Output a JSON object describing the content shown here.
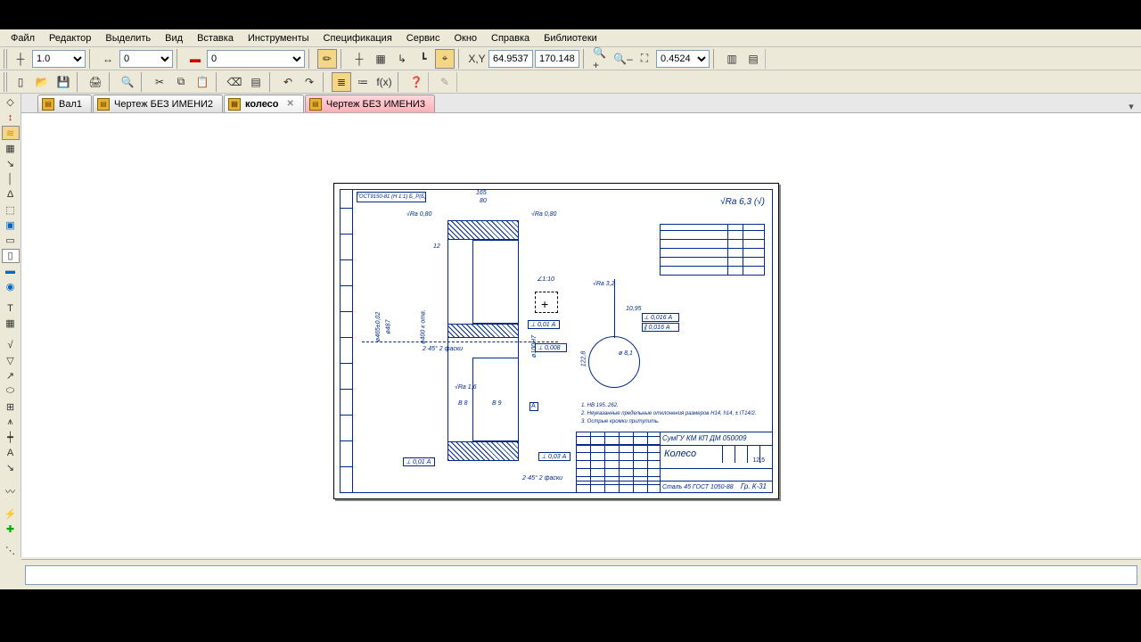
{
  "menu": {
    "items": [
      "Файл",
      "Редактор",
      "Выделить",
      "Вид",
      "Вставка",
      "Инструменты",
      "Спецификация",
      "Сервис",
      "Окно",
      "Справка",
      "Библиотеки"
    ]
  },
  "toolbar1": {
    "step": "1.0",
    "layer": "0",
    "style": "0",
    "coordX": "64.9537",
    "coordY": "170.148",
    "zoom": "0.4524"
  },
  "tabs": [
    {
      "label": "Вал1",
      "state": "normal"
    },
    {
      "label": "Чертеж БЕЗ ИМЕНИ2",
      "state": "normal"
    },
    {
      "label": "колесо",
      "state": "active"
    },
    {
      "label": "Чертеж БЕЗ ИМЕНИ3",
      "state": "pink"
    }
  ],
  "drawing": {
    "gost": "ГОСТ9150-81 (H 1:1) Б_Р(Б)",
    "ra_note": "√Ra 6,3 (√)",
    "dims": {
      "top1": "165",
      "top2": "80",
      "ra080a": "√Ra 0,80",
      "ra080b": "√Ra 0,80",
      "d12": "12",
      "d110": "∠1:10",
      "ra32": "√Ra 3,2",
      "d1095": "10,95",
      "tol1": "⊥ 0,016 А",
      "tol2": "∥ 0,016 А",
      "phi81": "ø 8,1",
      "d1228": "122,8",
      "phi465": "ø465±0,02",
      "phi487": "ø487",
      "phi400k": "ø400 к отв.",
      "phi100h7": "ø100H7",
      "chamf": "2·45°\n2 фаски",
      "ra16": "√Ra 1,6",
      "b8": "В 8",
      "datumA": "А",
      "tol001": "⊥ 0,01 А",
      "tol0008": "⊥ 0,008",
      "tol003": "⊥ 0,03 А",
      "n1": "В 9"
    },
    "notes": [
      "1. HB 195..262.",
      "2. Неуказанные предельные отклонения размеров H14, h14, ± IT14/2.",
      "3. Острые кромки притупить."
    ],
    "titleblock": {
      "code": "СумГУ КМ КП ДМ 050009",
      "name": "Колесо",
      "material": "Сталь 45 ГОСТ 1050-88",
      "group": "Гр. К-31",
      "mass": "12,5"
    }
  },
  "icons": {
    "new": "▯",
    "open": "📂",
    "save": "💾",
    "print": "🖨",
    "preview": "🔍",
    "cut": "✂",
    "copy": "⧉",
    "paste": "📋",
    "eraser": "⌫",
    "props": "▤",
    "undo": "↶",
    "redo": "↷",
    "layers": "≣",
    "vars": "≔",
    "fx": "f(x)",
    "help": "❓",
    "ortho": "┼",
    "grid": "▦",
    "axis": "↳",
    "snap": "⌖",
    "auto": "✶",
    "xy": "X,Y",
    "zin": "🔍+",
    "zout": "🔍–",
    "zall": "⛶",
    "scr1": "▥",
    "scr2": "▤",
    "eraser2": "✏",
    "dim": "↔"
  }
}
